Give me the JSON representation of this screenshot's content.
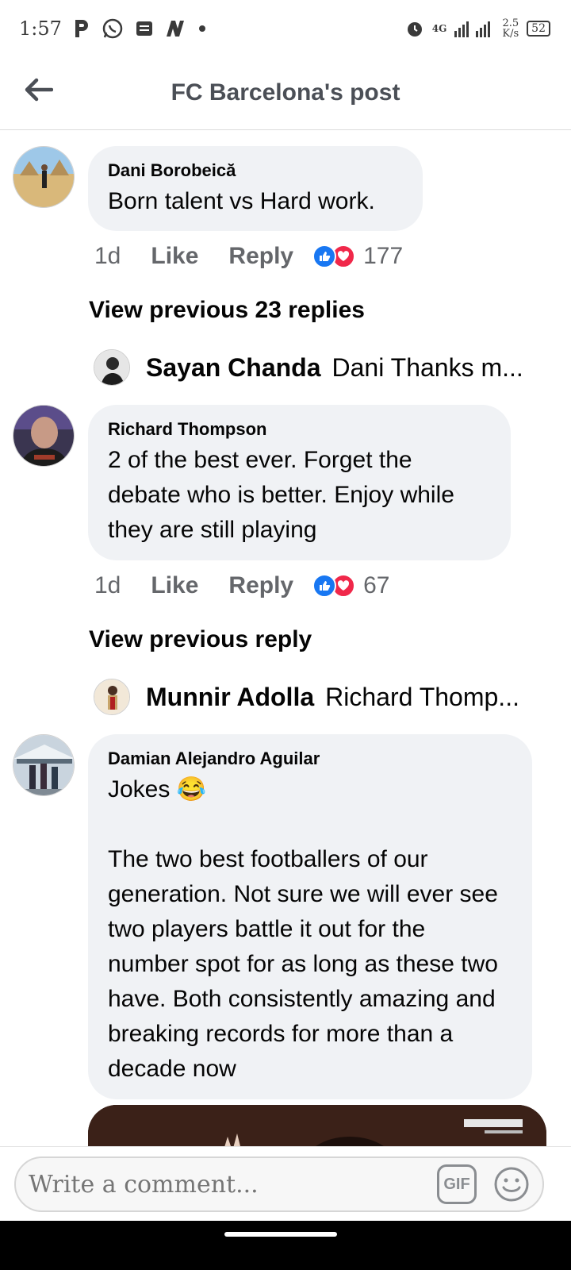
{
  "status_bar": {
    "time": "1:57",
    "network": "4G",
    "speed_value": "2.5",
    "speed_unit": "K/s",
    "battery": "52"
  },
  "header": {
    "title": "FC Barcelona's post"
  },
  "comments": [
    {
      "author": "Dani Borobeică",
      "text": "Born talent vs Hard work.",
      "time": "1d",
      "like_label": "Like",
      "reply_label": "Reply",
      "reaction_count": "177",
      "view_previous": "View previous 23 replies",
      "latest_reply": {
        "author": "Sayan Chanda",
        "preview": "Dani  Thanks m..."
      }
    },
    {
      "author": "Richard Thompson",
      "text": "2 of the best ever. Forget the debate who is better. Enjoy while they are still playing",
      "time": "1d",
      "like_label": "Like",
      "reply_label": "Reply",
      "reaction_count": "67",
      "view_previous": "View previous reply",
      "latest_reply": {
        "author": "Munnir Adolla",
        "preview": "Richard Thomp..."
      }
    },
    {
      "author": "Damian Alejandro Aguilar",
      "text": "Jokes 😂\n\nThe two best footballers of our generation. Not sure we will ever see two players battle it out for the number spot for as long as these two have. Both consistently amazing and breaking records for more than a decade now"
    }
  ],
  "composer": {
    "placeholder": "Write a comment...",
    "gif_label": "GIF"
  }
}
